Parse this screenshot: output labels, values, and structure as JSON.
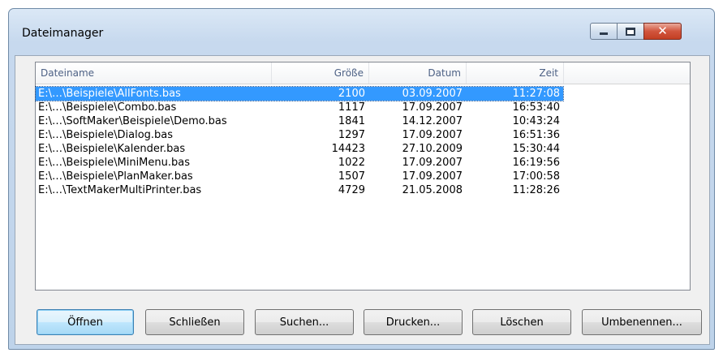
{
  "window": {
    "title": "Dateimanager"
  },
  "list": {
    "columns": [
      "Dateiname",
      "Größe",
      "Datum",
      "Zeit"
    ],
    "selected_index": 0,
    "rows": [
      {
        "name": "E:\\…\\Beispiele\\AllFonts.bas",
        "size": "2100",
        "date": "03.09.2007",
        "time": "11:27:08"
      },
      {
        "name": "E:\\…\\Beispiele\\Combo.bas",
        "size": "1117",
        "date": "17.09.2007",
        "time": "16:53:40"
      },
      {
        "name": "E:\\…\\SoftMaker\\Beispiele\\Demo.bas",
        "size": "1841",
        "date": "14.12.2007",
        "time": "10:43:24"
      },
      {
        "name": "E:\\…\\Beispiele\\Dialog.bas",
        "size": "1297",
        "date": "17.09.2007",
        "time": "16:51:36"
      },
      {
        "name": "E:\\…\\Beispiele\\Kalender.bas",
        "size": "14423",
        "date": "27.10.2009",
        "time": "15:30:44"
      },
      {
        "name": "E:\\…\\Beispiele\\MiniMenu.bas",
        "size": "1022",
        "date": "17.09.2007",
        "time": "16:19:56"
      },
      {
        "name": "E:\\…\\Beispiele\\PlanMaker.bas",
        "size": "1507",
        "date": "17.09.2007",
        "time": "17:00:58"
      },
      {
        "name": "E:\\…\\TextMakerMultiPrinter.bas",
        "size": "4729",
        "date": "21.05.2008",
        "time": "11:28:26"
      }
    ]
  },
  "buttons": {
    "open": "Öffnen",
    "close": "Schließen",
    "search": "Suchen...",
    "print": "Drucken...",
    "delete": "Löschen",
    "rename": "Umbenennen..."
  },
  "colors": {
    "selection": "#3399ff",
    "close_button": "#c94a32"
  },
  "icons": {
    "minimize": "minimize-icon",
    "maximize": "maximize-icon",
    "close": "close-icon"
  }
}
